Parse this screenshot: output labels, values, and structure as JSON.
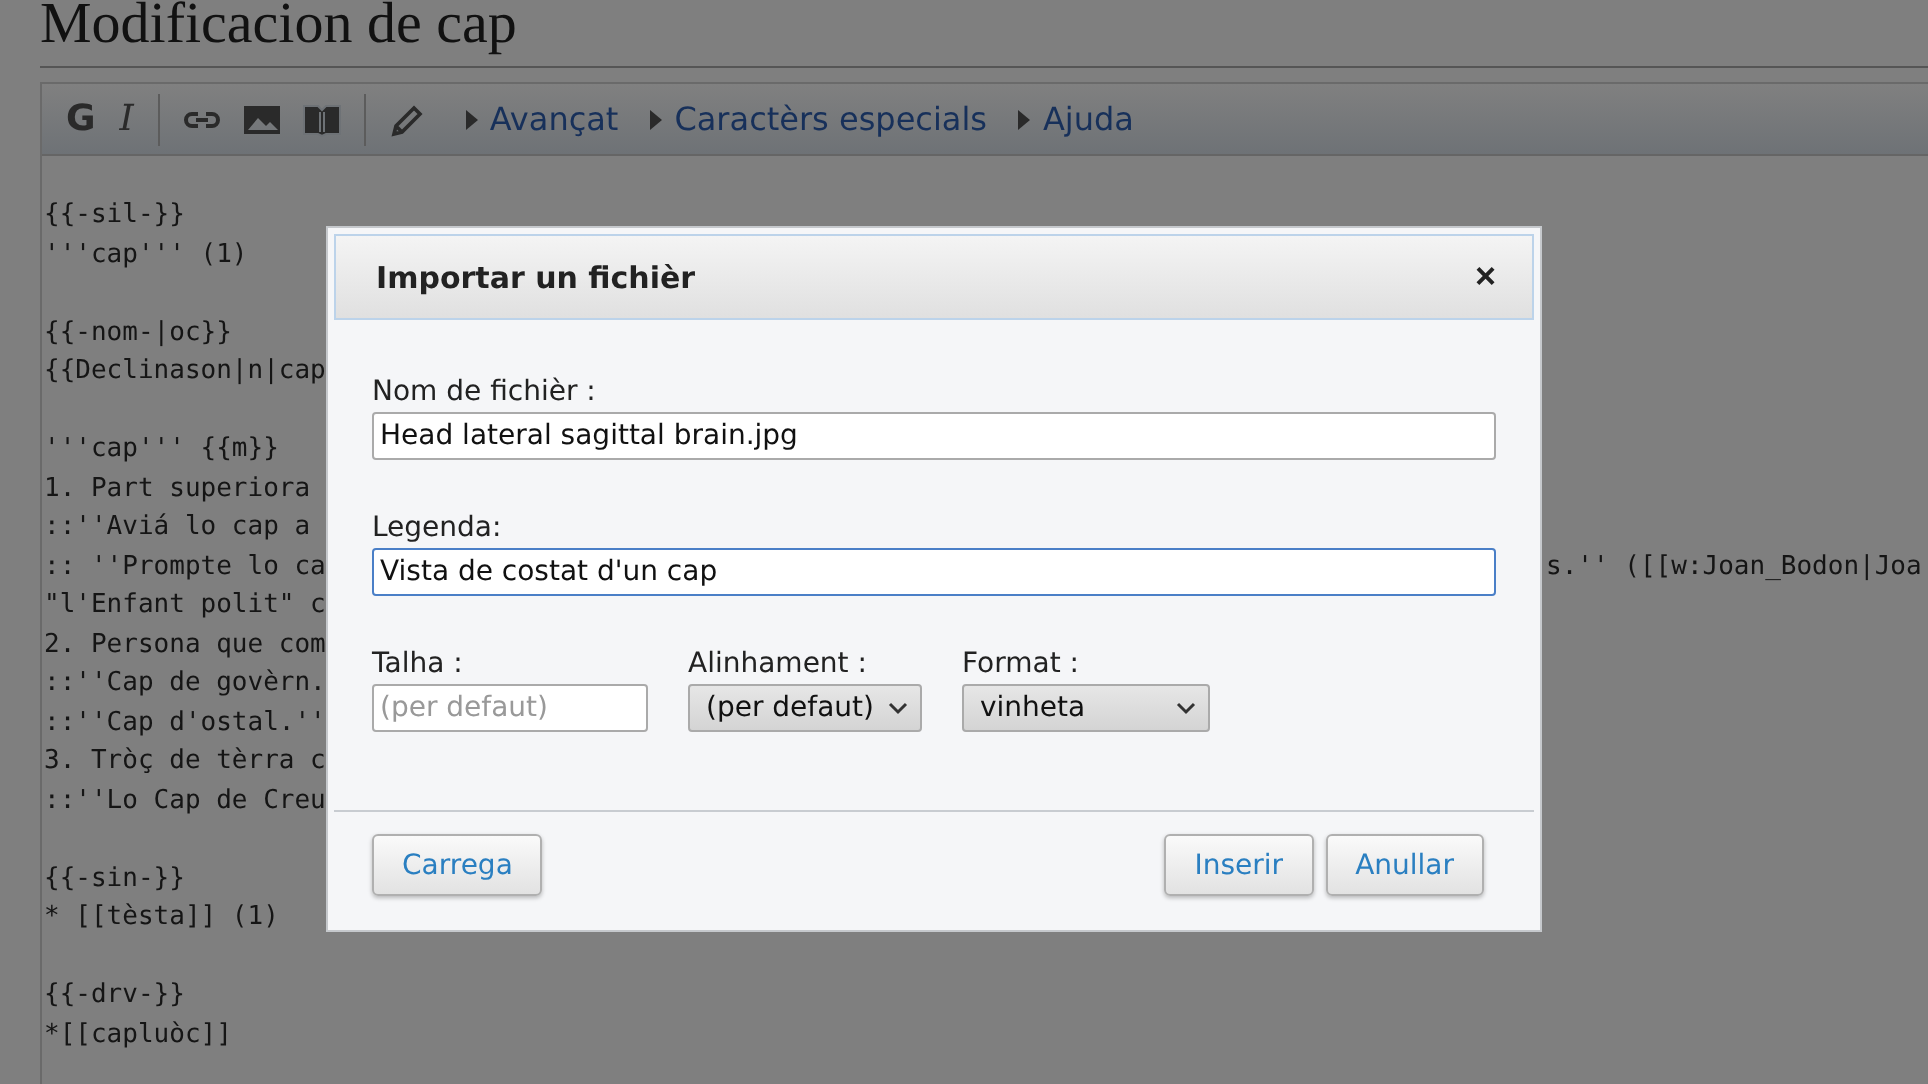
{
  "page_title": "Modificacion de cap",
  "toolbar": {
    "format_buttons": [
      "G",
      "I"
    ],
    "menus": [
      "Avançat",
      "Caractèrs especials",
      "Ajuda"
    ]
  },
  "editor_blocks": [
    [
      {
        "text": "{{-sil-}}"
      },
      {
        "text": "'''cap''' (1)"
      }
    ],
    [
      {
        "text": "{{-nom-|oc}}"
      },
      {
        "text": "{{Declinason|n|cap"
      }
    ],
    [
      {
        "text": "'''cap''' {{m}}"
      },
      {
        "text": "1. Part superiora"
      },
      {
        "text": "::''Aviá lo cap a"
      },
      {
        "text": ":: ''Prompte lo ca",
        "continuation": "s.'' ([[w:Joan_Bodon|Joa"
      },
      {
        "text": "\"l'Enfant polit\" c"
      },
      {
        "text": "2. Persona que com"
      },
      {
        "text": "::''Cap de govèrn."
      },
      {
        "text": "::''Cap d'ostal.''"
      },
      {
        "text": "3. Tròç de tèrra c"
      },
      {
        "text": "::''Lo Cap de Creu"
      }
    ],
    [
      {
        "text": "{{-sin-}}"
      },
      {
        "text": "* [[tèsta]] (1)"
      }
    ],
    [
      {
        "text": "{{-drv-}}"
      },
      {
        "text": "*[[capluòc]]"
      }
    ]
  ],
  "dialog": {
    "title": "Importar un fichièr",
    "close": "×",
    "fields": [
      {
        "label": "Nom de fichièr :",
        "value": "Head lateral sagittal brain.jpg",
        "focused": false
      },
      {
        "label": "Legenda:",
        "value": "Vista de costat d'un cap",
        "focused": true
      }
    ],
    "options": [
      {
        "kind": "text",
        "label": "Talha :",
        "placeholder": "(per defaut)"
      },
      {
        "kind": "select",
        "label": "Alinhament :",
        "value": "(per defaut)"
      },
      {
        "kind": "select",
        "label": "Format :",
        "value": "vinheta"
      }
    ],
    "buttons_left": [
      "Carrega"
    ],
    "buttons_right": [
      "Inserir",
      "Anullar"
    ]
  }
}
